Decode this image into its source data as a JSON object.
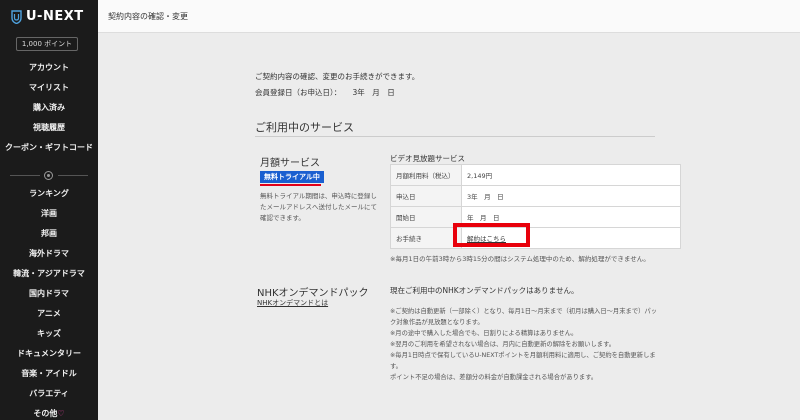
{
  "sidebar": {
    "logo_text": "U-NEXT",
    "points": "1,000 ポイント",
    "nav_primary": [
      "アカウント",
      "マイリスト",
      "購入済み",
      "視聴履歴",
      "クーポン・ギフトコード"
    ],
    "nav_genres": [
      "ランキング",
      "洋画",
      "邦画",
      "海外ドラマ",
      "韓流・アジアドラマ",
      "国内ドラマ",
      "アニメ",
      "キッズ",
      "ドキュメンタリー",
      "音楽・アイドル",
      "バラエティ"
    ],
    "nav_more": "その他",
    "colors": {
      "bg": "#1b1b1b",
      "heart": "#e0409a"
    }
  },
  "topbar": {
    "title": "契約内容の確認・変更"
  },
  "main": {
    "intro": "ご契約内容の確認、変更のお手続きができます。",
    "registration": "会員登録日（お申込日）：　　3年　月　日",
    "section_title": "ご利用中のサービス",
    "monthly": {
      "name": "月額サービス",
      "badge": "無料トライアル中",
      "note": "無料トライアル期間は、申込時に登録したメールアドレスへ送付したメールにて確認できます。",
      "table_title": "ビデオ見放題サービス",
      "rows": [
        {
          "key": "月額利用料（税込）",
          "value": "2,149円"
        },
        {
          "key": "申込日",
          "value": "3年　月　日"
        },
        {
          "key": "開始日",
          "value": "年　月　日"
        },
        {
          "key": "お手続き",
          "value": "解約はこちら"
        }
      ],
      "table_note": "※毎月1日の午前3時から3時15分の間はシステム処理中のため、解約処理ができません。"
    },
    "nhk": {
      "title": "NHKオンデマンドパック",
      "link": "NHKオンデマンドとは",
      "status": "現在ご利用中のNHKオンデマンドパックはありません。",
      "notes": [
        "※ご契約は自動更新（一部除く）となり、毎月1日〜月末まで（初月は購入日〜月末まで）パッ",
        "ク対象作品が見放題となります。",
        "※月の途中で購入した場合でも、日割りによる精算はありません。",
        "※翌月のご利用を希望されない場合は、月内に自動更新の解除をお願いします。",
        "※毎月1日時点で保有しているU-NEXTポイントを月額利用料に適用し、ご契約を自動更新しま",
        "す。",
        "ポイント不足の場合は、差額分の料金が自動課金される場合があります。"
      ]
    },
    "colors": {
      "badge": "#1a5fd0",
      "highlight": "#e8000b"
    }
  }
}
